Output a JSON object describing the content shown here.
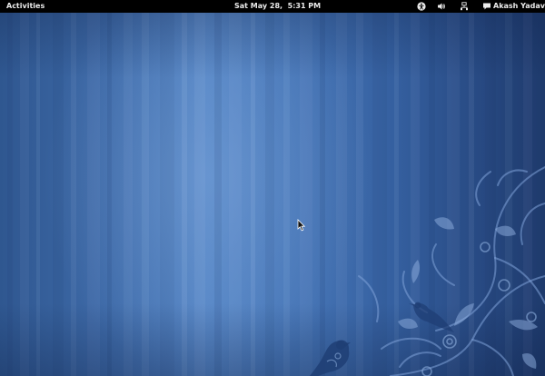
{
  "top_bar": {
    "activities_label": "Activities",
    "clock_text": "Sat May 28,  5:31 PM",
    "user_name": "Akash Yadav",
    "icons": [
      "accessibility-icon",
      "volume-icon",
      "network-icon",
      "chat-icon"
    ]
  },
  "desktop": {
    "icons": [
      "mouse-pointer-icon"
    ],
    "colors": {
      "bar": "#000000",
      "bar_text": "#ececec",
      "wallpaper_base": "#3e6aa8",
      "wallpaper_highlight": "#6b9ad6",
      "floral": "#7fa3d8"
    }
  }
}
